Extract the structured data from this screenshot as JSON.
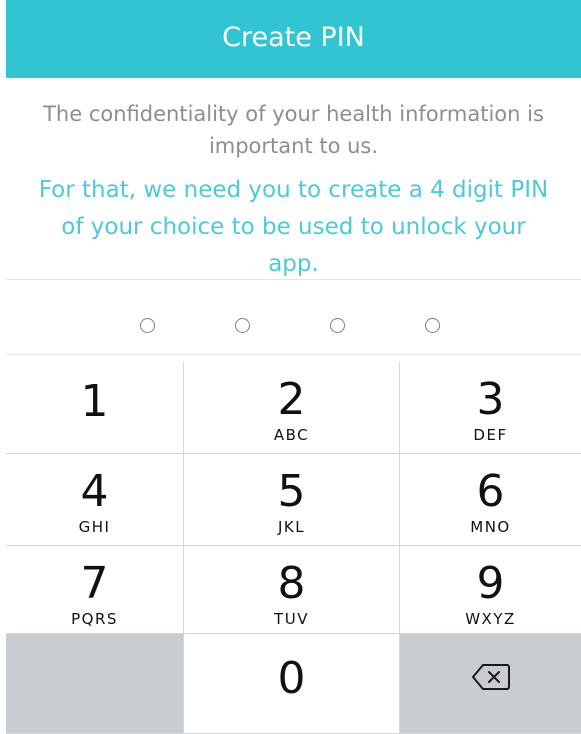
{
  "header": {
    "title": "Create PIN"
  },
  "info": {
    "primary": "The confidentiality of your health information is important to us.",
    "secondary": "For that, we need you to create a 4 digit PIN of your choice to be used to unlock your app."
  },
  "pin": {
    "length": 4,
    "entered": 0
  },
  "keypad": {
    "keys": [
      {
        "digit": "1",
        "letters": ""
      },
      {
        "digit": "2",
        "letters": "ABC"
      },
      {
        "digit": "3",
        "letters": "DEF"
      },
      {
        "digit": "4",
        "letters": "GHI"
      },
      {
        "digit": "5",
        "letters": "JKL"
      },
      {
        "digit": "6",
        "letters": "MNO"
      },
      {
        "digit": "7",
        "letters": "PQRS"
      },
      {
        "digit": "8",
        "letters": "TUV"
      },
      {
        "digit": "9",
        "letters": "WXYZ"
      },
      {
        "digit": "0",
        "letters": ""
      }
    ],
    "backspace_icon": "backspace-icon"
  },
  "colors": {
    "accent": "#33c4d2",
    "accent_text": "#4ec9d6",
    "muted_text": "#8e8e8e",
    "keypad_dark": "#c9ccd1"
  }
}
